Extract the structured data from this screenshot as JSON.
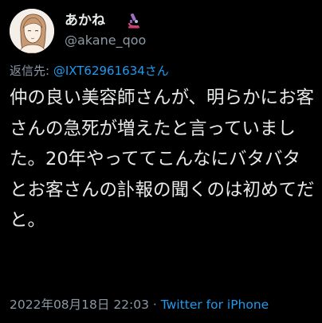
{
  "user": {
    "display_name": "あかね",
    "name_emoji": "microscope-icon",
    "handle": "@akane_qoo"
  },
  "reply": {
    "prefix": "返信先: ",
    "mention": "@IXT62961634さん"
  },
  "tweet": {
    "text": "仲の良い美容師さんが、明らかにお客さんの急死が増えたと言っていました。20年やっててこんなにバタバタとお客さんの訃報の聞くのは初めてだと。"
  },
  "meta": {
    "timestamp": "2022年08月18日 22:03",
    "separator": " · ",
    "source": "Twitter for iPhone"
  },
  "colors": {
    "background": "#000000",
    "text": "#e7e9ea",
    "secondary": "#8b98a5",
    "link": "#1d9bf0"
  }
}
